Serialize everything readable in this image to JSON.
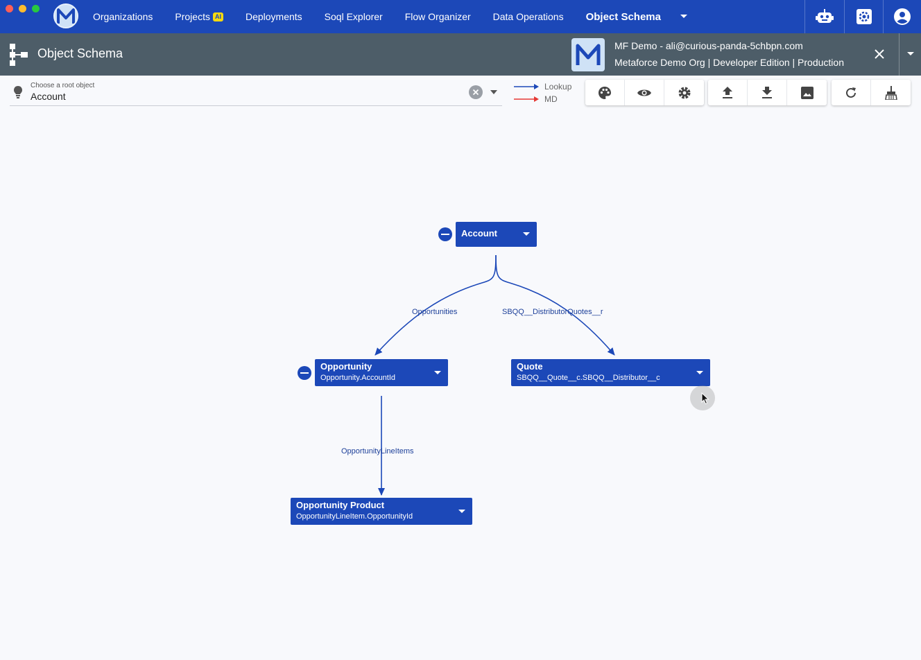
{
  "window": {
    "traffic_colors": [
      "#ff5f57",
      "#febc2e",
      "#28c840"
    ]
  },
  "nav": {
    "items": [
      {
        "label": "Organizations"
      },
      {
        "label": "Projects",
        "badge": "AI"
      },
      {
        "label": "Deployments"
      },
      {
        "label": "Soql Explorer"
      },
      {
        "label": "Flow Organizer"
      },
      {
        "label": "Data Operations"
      },
      {
        "label": "Object Schema",
        "active": true
      }
    ],
    "icons": [
      "robot-icon",
      "settings-icon",
      "account-circle-icon"
    ]
  },
  "header": {
    "title": "Object Schema",
    "org_line1": "MF Demo - ali@curious-panda-5chbpn.com",
    "org_line2": "Metaforce Demo Org | Developer Edition | Production"
  },
  "root_select": {
    "label": "Choose a root object",
    "value": "Account"
  },
  "legend": {
    "lookup_label": "Lookup",
    "lookup_color": "#1c48b8",
    "md_label": "MD",
    "md_color": "#e53935"
  },
  "toolbar": {
    "group1": [
      "palette-icon",
      "eye-icon",
      "gear-icon"
    ],
    "group2": [
      "upload-icon",
      "download-icon",
      "image-icon"
    ],
    "group3": [
      "refresh-icon",
      "broom-icon"
    ]
  },
  "schema": {
    "nodes": {
      "account": {
        "title": "Account"
      },
      "opportunity": {
        "title": "Opportunity",
        "sub": "Opportunity.AccountId"
      },
      "quote": {
        "title": "Quote",
        "sub": "SBQQ__Quote__c.SBQQ__Distributor__c"
      },
      "opp_product": {
        "title": "Opportunity Product",
        "sub": "OpportunityLineItem.OpportunityId"
      }
    },
    "edges": {
      "opportunities": "Opportunities",
      "distributor_quotes": "SBQQ__DistributorQuotes__r",
      "line_items": "OpportunityLineItems"
    },
    "node_color": "#1c48b8"
  }
}
